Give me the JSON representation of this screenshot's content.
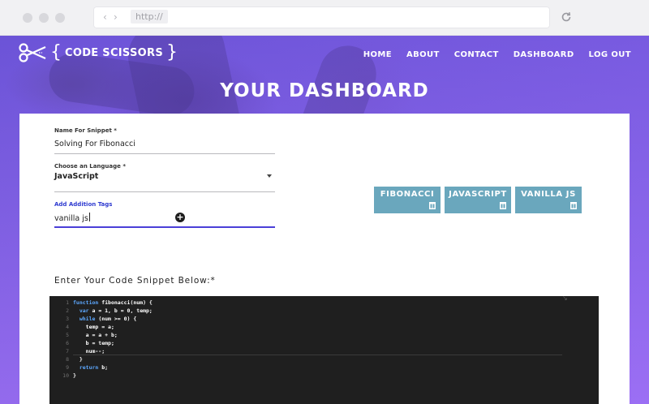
{
  "browser": {
    "url": "http://",
    "back_icon": "chevron-left-icon",
    "forward_icon": "chevron-right-icon",
    "reload_icon": "reload-icon"
  },
  "header": {
    "logo_text": "CODE SCISSORS",
    "nav": [
      "HOME",
      "ABOUT",
      "CONTACT",
      "DASHBOARD",
      "LOG OUT"
    ]
  },
  "page": {
    "title": "YOUR DASHBOARD"
  },
  "form": {
    "name_label": "Name For Snippet *",
    "name_value": "Solving For Fibonacci",
    "language_label": "Choose an Language *",
    "language_value": "JavaScript",
    "tags_label": "Add Addition Tags",
    "tags_value": "vanilla js"
  },
  "tags": [
    "FIBONACCI",
    "JAVASCRIPT",
    "VANILLA JS"
  ],
  "code_section": {
    "label": "Enter Your Code Snippet Below:*",
    "lines": [
      {
        "n": "1",
        "text": "function fibonacci(num) {"
      },
      {
        "n": "2",
        "text": "  var a = 1, b = 0, temp;"
      },
      {
        "n": "3",
        "text": "  while (num >= 0) {"
      },
      {
        "n": "4",
        "text": "    temp = a;"
      },
      {
        "n": "5",
        "text": "    a = a + b;"
      },
      {
        "n": "6",
        "text": "    b = temp;"
      },
      {
        "n": "7",
        "text": "    num--;"
      },
      {
        "n": "8",
        "text": "  }"
      },
      {
        "n": "9",
        "text": "  return b;"
      },
      {
        "n": "10",
        "text": "}"
      }
    ]
  },
  "colors": {
    "accent": "#6b54d6",
    "tag": "#6aa7bd",
    "editor_bg": "#1f1f1f"
  }
}
